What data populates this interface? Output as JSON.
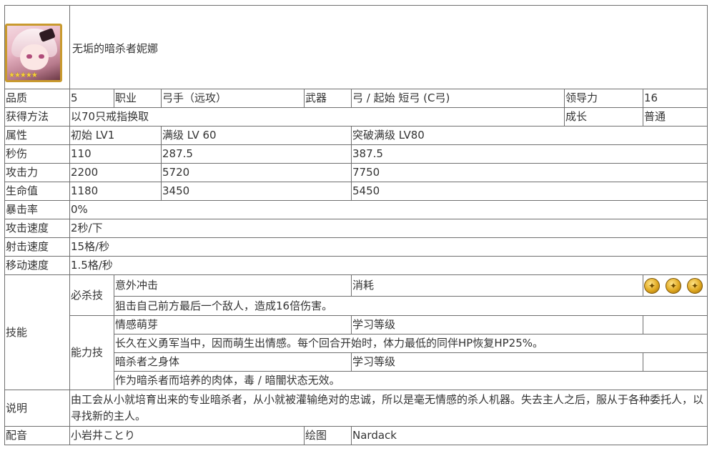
{
  "header": {
    "name": "无垢的暗杀者妮娜",
    "avatar_stars": "★★★★★"
  },
  "labels": {
    "quality": "品质",
    "job": "职业",
    "weapon": "武器",
    "leadership": "领导力",
    "obtain": "获得方法",
    "growth": "成长",
    "attribute": "属性",
    "dps": "秒伤",
    "attack": "攻击力",
    "hp": "生命值",
    "crit": "暴击率",
    "atk_speed": "攻击速度",
    "shot_speed": "射击速度",
    "move_speed": "移动速度",
    "skills": "技能",
    "special_skill": "必杀技",
    "ability_skill": "能力技",
    "cost": "消耗",
    "learn_level": "学习等级",
    "description": "说明",
    "voice": "配音",
    "illustration": "绘图"
  },
  "values": {
    "quality": "5",
    "job": "弓手（远攻）",
    "weapon": "弓 / 起始 短弓 (C弓)",
    "leadership": "16",
    "obtain": "以70只戒指换取",
    "growth": "普通",
    "crit": "0%",
    "atk_speed": "2秒/下",
    "shot_speed": "15格/秒",
    "move_speed": "1.5格/秒",
    "description": "由工会从小就培育出来的专业暗杀者，从小就被灌输绝对的忠诚，所以是毫无情感的杀人机器。失去主人之后，服从于各种委托人，以寻找新的主人。",
    "voice": "小岩井ことり",
    "illustration": "Nardack"
  },
  "stats": {
    "headers": [
      "初始 LV1",
      "满级 LV 60",
      "突破满级 LV80"
    ],
    "dps": [
      "110",
      "287.5",
      "387.5"
    ],
    "attack": [
      "2200",
      "5720",
      "7750"
    ],
    "hp": [
      "1180",
      "3450",
      "5450"
    ]
  },
  "special": {
    "name": "意外冲击",
    "desc": "狙击自己前方最后一个敌人，造成16倍伤害。",
    "cost_icon": "gold-coin-icon",
    "cost_count": 3
  },
  "abilities": [
    {
      "name": "情感萌芽",
      "level": "",
      "desc": "长久在义勇军当中，因而萌生出情感。每个回合开始时，体力最低的同伴HP恢复HP25%。"
    },
    {
      "name": "暗杀者之身体",
      "level": "",
      "desc": "作为暗杀者而培养的肉体，毒 / 暗闇状态无效。"
    }
  ]
}
